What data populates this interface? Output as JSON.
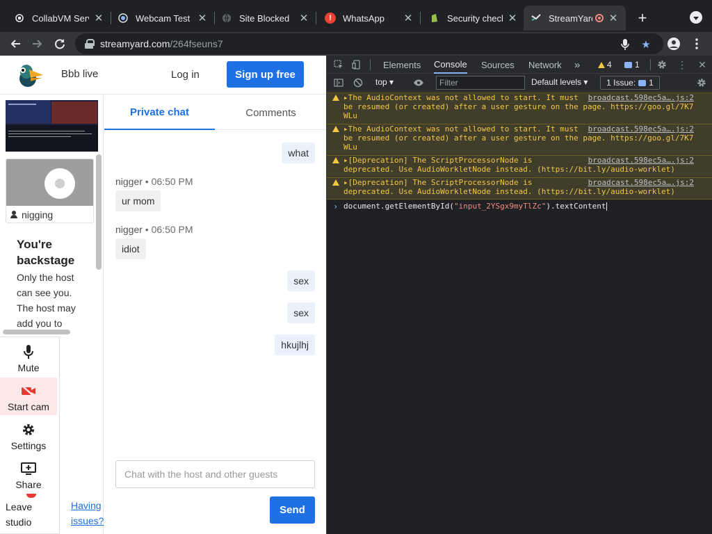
{
  "browser": {
    "tabs": [
      {
        "title": "CollabVM Serv",
        "favicon": "collabvm-icon",
        "favicon_color": "#e8eaed"
      },
      {
        "title": "Webcam Test -",
        "favicon": "webcam-icon",
        "favicon_color": "#e8eaed"
      },
      {
        "title": "Site Blocked",
        "favicon": "globe-icon",
        "favicon_color": "#9aa0a6"
      },
      {
        "title": "WhatsApp",
        "favicon": "alert-icon",
        "favicon_color": "#ea4335"
      },
      {
        "title": "Security check",
        "favicon": "shopify-icon",
        "favicon_color": "#95bf47"
      },
      {
        "title": "StreamYard",
        "favicon": "streamyard-icon",
        "favicon_color": "#e8eaed",
        "recording": true
      }
    ],
    "address": {
      "domain": "streamyard.com",
      "path": "/264fseuns7"
    }
  },
  "streamyard": {
    "header": {
      "broadcast_name": "Bbb live",
      "login": "Log in",
      "signup": "Sign up free"
    },
    "guest_name": "nigging",
    "backstage": {
      "title": "You're backstage",
      "text": "Only the host can see you. The host may add you to"
    },
    "controls": {
      "mute": "Mute",
      "cam": "Start cam",
      "settings": "Settings",
      "share": "Share",
      "leave": "Leave studio",
      "issues": "Having issues?"
    },
    "chat": {
      "tabs": [
        "Private chat",
        "Comments"
      ],
      "messages": [
        {
          "side": "right",
          "text": "what"
        },
        {
          "side": "left",
          "author": "nigger",
          "time": "06:50 PM",
          "text": "ur mom"
        },
        {
          "side": "left",
          "author": "nigger",
          "time": "06:50 PM",
          "text": "idiot"
        },
        {
          "side": "right",
          "text": "sex"
        },
        {
          "side": "right",
          "text": "sex"
        },
        {
          "side": "right",
          "text": "hkujlhj"
        }
      ],
      "input_placeholder": "Chat with the host and other guests",
      "send": "Send"
    }
  },
  "devtools": {
    "tabs": [
      "Elements",
      "Console",
      "Sources",
      "Network"
    ],
    "warnings": "4",
    "info": "1",
    "context": "top",
    "filter_placeholder": "Filter",
    "levels": "Default levels",
    "issues": "1 Issue:",
    "issues_count": "1",
    "logs": [
      {
        "text": "▸The AudioContext was not allowed to start. It must\nbe resumed (or created) after a user gesture on the page. https://goo.gl/7K7\nWLu",
        "source": "broadcast.598ec5a….js:2"
      },
      {
        "text": "▸The AudioContext was not allowed to start. It must\nbe resumed (or created) after a user gesture on the page. https://goo.gl/7K7\nWLu",
        "source": "broadcast.598ec5a….js:2"
      },
      {
        "text": "▸[Deprecation] The ScriptProcessorNode is\ndeprecated. Use AudioWorkletNode instead. (https://bit.ly/audio-worklet)",
        "source": "broadcast.598ec5a….js:2"
      },
      {
        "text": "▸[Deprecation] The ScriptProcessorNode is\ndeprecated. Use AudioWorkletNode instead. (https://bit.ly/audio-worklet)",
        "source": "broadcast.598ec5a….js:2"
      }
    ],
    "prompt_prefix": "document.getElementById(",
    "prompt_string": "\"input_2YSgx9myTlZc\"",
    "prompt_suffix": ").textContent"
  }
}
